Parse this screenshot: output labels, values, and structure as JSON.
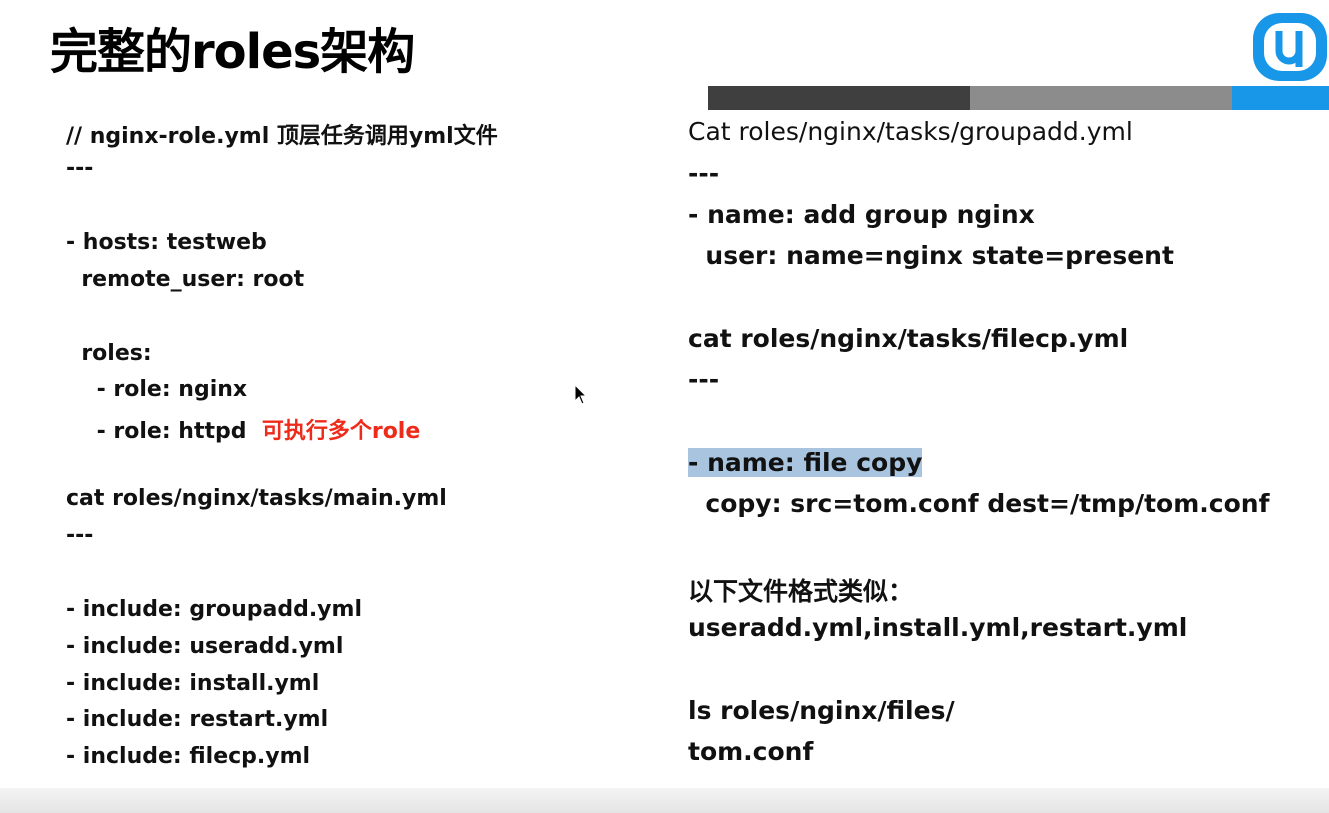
{
  "slide": {
    "title": "完整的roles架构",
    "left": {
      "lines": [
        "// nginx-role.yml 顶层任务调用yml文件",
        "---",
        "- hosts: testweb",
        "  remote_user: root",
        "  roles:",
        "    - role: nginx",
        "    - role: httpd",
        "cat roles/nginx/tasks/main.yml",
        "---",
        "- include: groupadd.yml",
        "- include: useradd.yml",
        "- include: install.yml",
        "- include: restart.yml",
        "- include: filecp.yml"
      ],
      "note": "可执行多个role"
    },
    "right": {
      "lines": [
        "Cat roles/nginx/tasks/groupadd.yml",
        "---",
        "- name: add group nginx",
        "  user: name=nginx state=present",
        "cat roles/nginx/tasks/filecp.yml",
        "---",
        "- name: file copy",
        "  copy: src=tom.conf dest=/tmp/tom.conf",
        "以下文件格式类似：",
        "useradd.yml,install.yml,restart.yml",
        "ls roles/nginx/files/",
        "tom.conf"
      ]
    },
    "colors": {
      "note": "#ee2b1a",
      "highlight": "#a9c4df",
      "bar_dark": "#3f3f3f",
      "bar_mid": "#8c8c8c",
      "bar_blue": "#1896e8"
    }
  }
}
